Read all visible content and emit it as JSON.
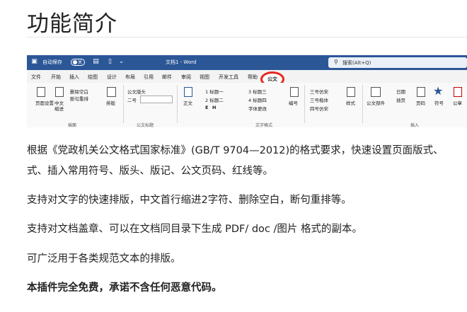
{
  "page": {
    "title": "功能简介"
  },
  "word": {
    "autosave": "自动保存",
    "toggle_state": "关",
    "doc_title": "文档1 - Word",
    "search_placeholder": "搜索(Alt+Q)",
    "tabs": [
      "文件",
      "开始",
      "插入",
      "绘图",
      "设计",
      "布局",
      "引用",
      "邮件",
      "审阅",
      "视图",
      "开发工具",
      "帮助"
    ],
    "active_tab": "公文",
    "ribbon": {
      "page_setup": "页面设置",
      "center_text": "中文",
      "indent": "缩进",
      "delete_space": "删除空白",
      "break_lines": "断句重排",
      "paste_plain": "纯文本",
      "layout_label": "排版",
      "group_layout": "插面",
      "doc_header": "公文版头",
      "secondary": "二号",
      "group_doc": "公文标题",
      "body_text": "正文",
      "h1": "1  标题一",
      "h2": "2  标题二",
      "h3": "3  标题三",
      "h4": "4  标题四",
      "e": "E",
      "h": "H",
      "group_text": "文字格式",
      "numbering": "编号",
      "font_change": "字体更改",
      "font_fangsong": "三号仿宋",
      "font_kai": "三号楷体",
      "font_kai2": "四号仿宋",
      "style_label": "样式",
      "group_style": "样式",
      "doc_parts": "公文部件",
      "date_label": "日期",
      "stamp_label": "插页",
      "page_num": "页码",
      "symbol": "符号",
      "seal": "公章",
      "group_insert": "插入"
    }
  },
  "paragraphs": [
    "根据《党政机关公文格式国家标准》(GB/T 9704—2012)的格式要求，快速设置页面版式、",
    "式、插入常用符号、版头、版记、公文页码、红线等。",
    "支持对文字的快速排版，中文首行缩进2字符、删除空白，断句重排等。",
    "支持对文档盖章、可以在文档同目录下生成 PDF/ doc /图片 格式的副本。",
    "可广泛用于各类规范文本的排版。",
    "本插件完全免费，承诺不含任何恶意代码。"
  ],
  "colors": {
    "word_blue": "#2b5797",
    "highlight_red": "#e8261e"
  }
}
